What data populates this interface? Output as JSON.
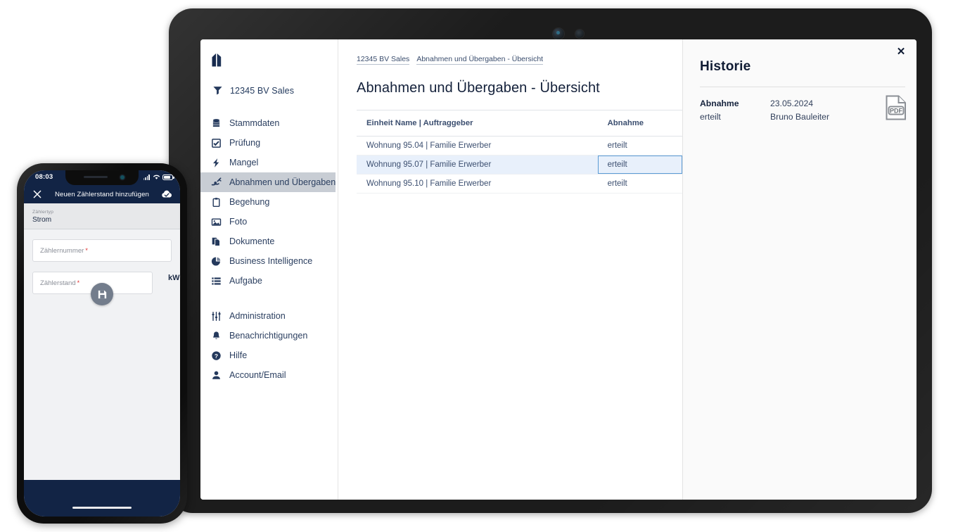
{
  "tablet_app": {
    "logo_name": "n-logo",
    "sidebar": {
      "filter": {
        "icon": "filter-icon",
        "label": "12345 BV Sales"
      },
      "groups": [
        {
          "items": [
            {
              "icon": "database-icon",
              "label": "Stammdaten"
            },
            {
              "icon": "checkbox-icon",
              "label": "Prüfung"
            },
            {
              "icon": "lightning-icon",
              "label": "Mangel"
            },
            {
              "icon": "signature-icon",
              "label": "Abnahmen und Übergaben",
              "active": true
            },
            {
              "icon": "clipboard-icon",
              "label": "Begehung"
            },
            {
              "icon": "photo-icon",
              "label": "Foto"
            },
            {
              "icon": "documents-icon",
              "label": "Dokumente"
            },
            {
              "icon": "piechart-icon",
              "label": "Business Intelligence"
            },
            {
              "icon": "tasklist-icon",
              "label": "Aufgabe"
            }
          ]
        },
        {
          "items": [
            {
              "icon": "sliders-icon",
              "label": "Administration"
            },
            {
              "icon": "bell-icon",
              "label": "Benachrichtigungen"
            },
            {
              "icon": "help-icon",
              "label": "Hilfe"
            },
            {
              "icon": "user-icon",
              "label": "Account/Email"
            }
          ]
        }
      ]
    },
    "main": {
      "breadcrumb": [
        "12345 BV Sales",
        "Abnahmen und Übergaben - Übersicht"
      ],
      "page_title": "Abnahmen und Übergaben - Übersicht",
      "table": {
        "columns": [
          "Einheit Name | Auftraggeber",
          "Abnahme"
        ],
        "rows": [
          {
            "unit": "Wohnung 95.04 | Familie Erwerber",
            "abnahme": "erteilt",
            "selected": false
          },
          {
            "unit": "Wohnung 95.07 | Familie Erwerber",
            "abnahme": "erteilt",
            "selected": true
          },
          {
            "unit": "Wohnung 95.10 | Familie Erwerber",
            "abnahme": "erteilt",
            "selected": false
          }
        ]
      }
    },
    "history": {
      "title": "Historie",
      "close_icon": "close-icon",
      "entries": [
        {
          "type": "Abnahme",
          "status": "erteilt",
          "date": "23.05.2024",
          "person": "Bruno Bauleiter",
          "attachment_icon": "pdf-file-icon"
        }
      ]
    }
  },
  "phone_app": {
    "status_bar": {
      "time": "08:03",
      "signal_icon": "cellular-signal-icon",
      "wifi_icon": "wifi-icon",
      "battery_icon": "battery-icon"
    },
    "header": {
      "close_icon": "close-icon",
      "title": "Neuen Zählerstand hinzufügen",
      "sync_icon": "cloud-check-icon"
    },
    "form": {
      "meter_type_label": "Zählertyp",
      "meter_type_value": "Strom",
      "meter_number_placeholder": "Zählernummer",
      "meter_reading_placeholder": "Zählerstand",
      "unit": "kWh",
      "required_marker": "*"
    },
    "save_icon": "floppy-save-icon"
  },
  "colors": {
    "navy": "#122445",
    "sidebar_text": "#2b3f60",
    "active_item_bg": "#c8cdd4",
    "row_selected_bg": "#e8f0fb",
    "focus_border": "#5b9bd5",
    "required_red": "#e03131",
    "fab_grey": "#737d8c"
  }
}
